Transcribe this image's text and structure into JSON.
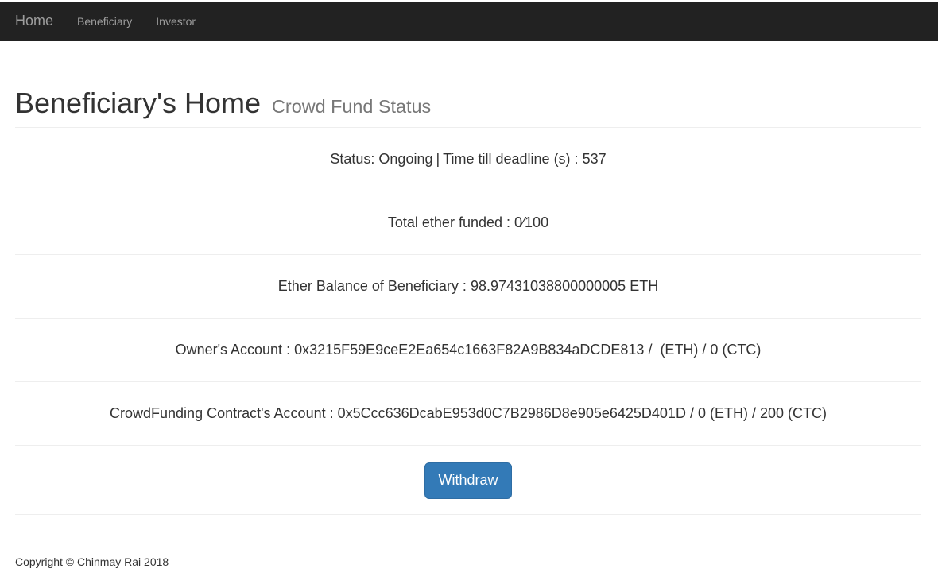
{
  "navbar": {
    "brand": "Home",
    "links": [
      "Beneficiary",
      "Investor"
    ]
  },
  "header": {
    "title": "Beneficiary's Home",
    "subtitle": "Crowd Fund Status"
  },
  "status": {
    "status_label": "Status:",
    "status_value": "Ongoing",
    "separator": "|",
    "deadline_label": "Time till deadline (s) :",
    "deadline_value": "537"
  },
  "funding": {
    "label": "Total ether funded :",
    "funded": "0",
    "slash": "⁄",
    "goal": "100"
  },
  "balance": {
    "label": "Ether Balance of Beneficiary :",
    "value": "98.97431038800000005",
    "unit": "ETH"
  },
  "owner": {
    "label": "Owner's Account :",
    "address": "0x3215F59E9ceE2Ea654c1663F82A9B834aDCDE813",
    "eth_part": "/  (ETH) / 0 (CTC)"
  },
  "contract": {
    "label": "CrowdFunding Contract's Account :",
    "address": "0x5Ccc636DcabE953d0C7B2986D8e905e6425D401D",
    "eth_part": "/ 0 (ETH) / 200 (CTC)"
  },
  "actions": {
    "withdraw_label": "Withdraw"
  },
  "footer": {
    "copyright": "Copyright © Chinmay Rai 2018"
  },
  "colors": {
    "navbar_bg": "#222222",
    "nav_text": "#9d9d9d",
    "button_primary": "#337ab7",
    "subtitle": "#777777"
  }
}
